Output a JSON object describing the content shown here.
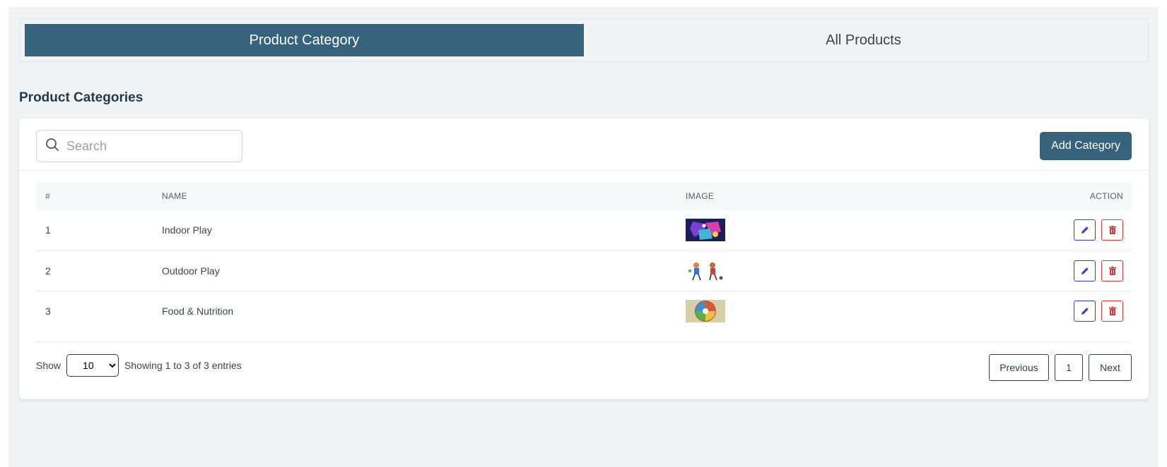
{
  "tabs": [
    {
      "label": "Product Category",
      "active": true
    },
    {
      "label": "All Products",
      "active": false
    }
  ],
  "section_title": "Product Categories",
  "toolbar": {
    "search_placeholder": "Search",
    "add_label": "Add Category"
  },
  "table": {
    "headers": {
      "num": "#",
      "name": "NAME",
      "image": "IMAGE",
      "action": "ACTION"
    },
    "rows": [
      {
        "num": "1",
        "name": "Indoor Play"
      },
      {
        "num": "2",
        "name": "Outdoor Play"
      },
      {
        "num": "3",
        "name": "Food & Nutrition"
      }
    ]
  },
  "footer": {
    "show_label": "Show",
    "page_size": "10",
    "entries_text": "Showing 1 to 3 of 3 entries"
  },
  "pagination": {
    "previous": "Previous",
    "current": "1",
    "next": "Next"
  },
  "colors": {
    "primary": "#36627b",
    "edit": "#3b3bd6",
    "delete": "#d63b3b"
  },
  "icons": {
    "search": "search-icon",
    "edit": "pencil-icon",
    "delete": "trash-icon"
  }
}
